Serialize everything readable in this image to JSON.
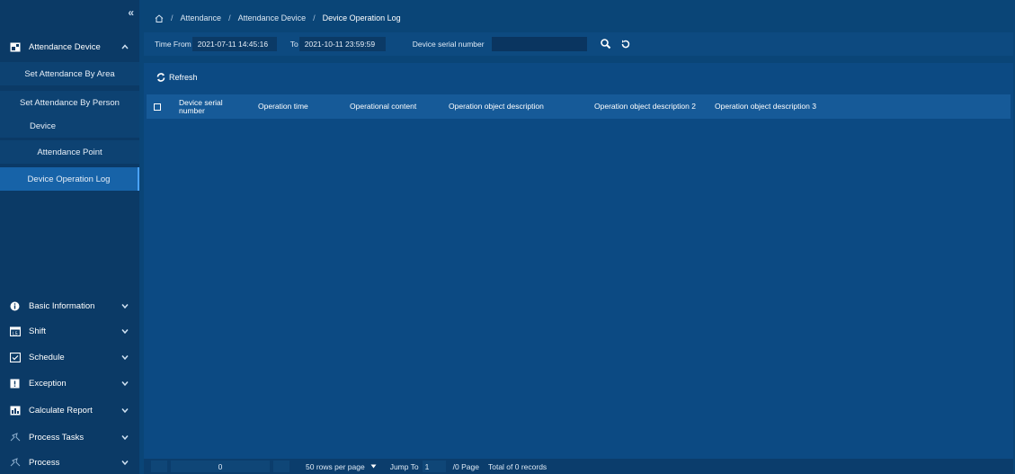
{
  "breadcrumb": {
    "items": [
      "Attendance",
      "Attendance Device",
      "Device Operation Log"
    ]
  },
  "sidebar": {
    "collapse_glyph": "«",
    "group_open": {
      "label": "Attendance Device",
      "icon": "device-icon"
    },
    "subitems": [
      {
        "label": "Set Attendance By Area"
      },
      {
        "label": "Set Attendance By Person"
      },
      {
        "label": "Device"
      },
      {
        "label": "Attendance Point"
      },
      {
        "label": "Device Operation Log",
        "active": true
      }
    ],
    "groups": [
      {
        "label": "Basic Information",
        "icon": "info-icon"
      },
      {
        "label": "Shift",
        "icon": "shift-icon"
      },
      {
        "label": "Schedule",
        "icon": "schedule-icon"
      },
      {
        "label": "Exception",
        "icon": "exception-icon"
      },
      {
        "label": "Calculate Report",
        "icon": "report-icon"
      },
      {
        "label": "Process Tasks",
        "icon": "process-tasks-icon"
      },
      {
        "label": "Process",
        "icon": "process-icon"
      }
    ]
  },
  "filter": {
    "time_from_label": "Time From",
    "time_from_value": "2021-07-11 14:45:16",
    "to_label": "To",
    "to_value": "2021-10-11 23:59:59",
    "serial_label": "Device serial number",
    "serial_value": ""
  },
  "toolbar": {
    "refresh_label": "Refresh"
  },
  "table": {
    "columns": [
      "Device serial number",
      "Operation time",
      "Operational content",
      "Operation object description",
      "Operation object description 2",
      "Operation object description 3"
    ],
    "rows": []
  },
  "pagination": {
    "current_page": "0",
    "rows_per_page": "50 rows per page",
    "jump_to_label": "Jump To",
    "jump_to_value": "1",
    "page_suffix": "/0 Page",
    "total": "Total of 0 records"
  },
  "colors": {
    "background": "#0a4577",
    "sidebar": "#0b3a66",
    "active_item": "#1763a8",
    "table_header": "#165a98"
  }
}
